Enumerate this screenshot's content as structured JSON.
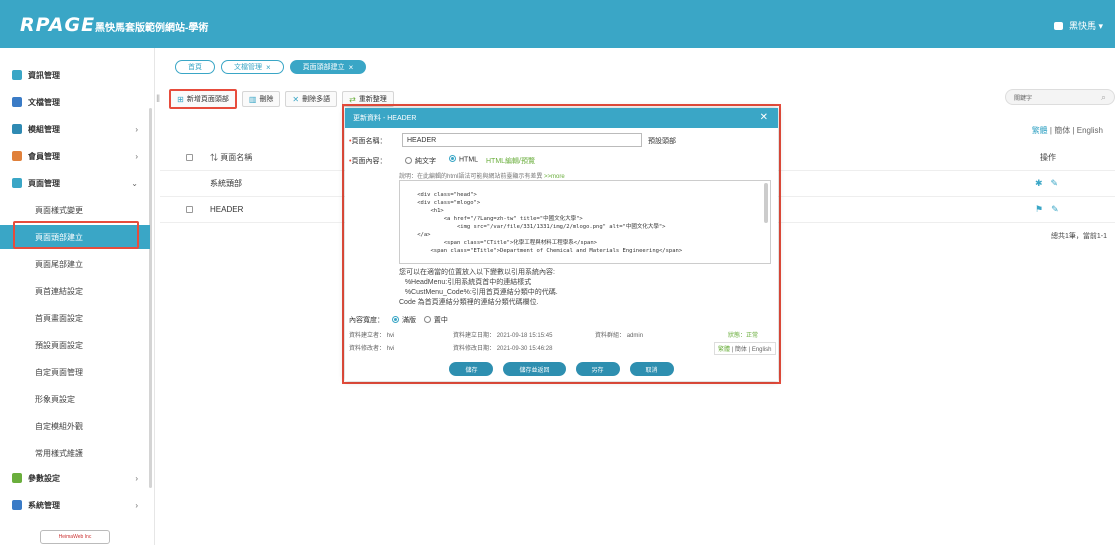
{
  "header": {
    "logo": "RPAGE",
    "site_name": "黑快馬套版範例網站-學術",
    "user": "黑快馬 ▾"
  },
  "sidebar": {
    "items": [
      {
        "label": "資訊管理",
        "color": "#3aa6c6"
      },
      {
        "label": "文檔管理",
        "color": "#3a7bc6"
      },
      {
        "label": "模組管理",
        "color": "#2f8ab3"
      },
      {
        "label": "會員管理",
        "color": "#e0803a"
      },
      {
        "label": "頁面管理",
        "color": "#3aa6c6"
      }
    ],
    "sub_items": [
      "頁面樣式變更",
      "頁面頭部建立",
      "頁面尾部建立",
      "頁首連結設定",
      "首頁畫面設定",
      "預設頁面設定",
      "自定頁面管理",
      "形象頁設定",
      "自定模組外觀",
      "常用樣式維護"
    ],
    "bottom_items": [
      {
        "label": "參數設定",
        "color": "#6aae3c"
      },
      {
        "label": "系統管理",
        "color": "#3a7bc6"
      }
    ],
    "powered": "HeimaWeb Inc"
  },
  "tabs": [
    {
      "label": "首頁",
      "closable": ""
    },
    {
      "label": "文檔管理",
      "closable": "×"
    },
    {
      "label": "頁面頭部建立",
      "closable": "×"
    }
  ],
  "toolbar": {
    "add": "新增頁面頭部",
    "delete": "刪除",
    "delete_multi": "刪除多語",
    "reorder": "重新整理"
  },
  "search": {
    "placeholder": "關鍵字"
  },
  "language": {
    "current": "繁體",
    "others": [
      "簡体",
      "English"
    ]
  },
  "table": {
    "headers": {
      "name": "頁面名稱",
      "op": "操作"
    },
    "rows": [
      {
        "name": "系統頭部"
      },
      {
        "name": "HEADER"
      }
    ],
    "pager": "總共1筆，當前1-1"
  },
  "modal": {
    "title": "更新資料 - HEADER",
    "name_label": "頁面名稱：",
    "name_value": "HEADER",
    "name_hint": "預設頭部",
    "content_label": "頁面內容：",
    "opt_text": "純文字",
    "opt_html": "HTML",
    "opt_editor": "HTML編輯/預覽",
    "note": "說明：在此編輯的html語法可能與網站前臺顯示有差異",
    "note_more": ">>more",
    "code": "<div class=\"head\">\n    <div class=\"mlogo\">\n        <h1>\n            <a href=\"/?Lang=zh-tw\" title=\"中國文化大學\">\n                <img src=\"/var/file/331/1331/img/2/mlogo.png\" alt=\"中國文化大學\">\n    </a>\n            <span class=\"CTitle\">化學工程與材料工程學系</span>\n        <span class=\"ETitle\">Department of Chemical and Materials Engineering</span>",
    "desc": "您可以在適當的位置放入以下變數以引用系統內容:\n   %HeadMenu:引用系統頁首中的連結樣式\n   %CustMenu_Code%:引用首頁連結分類中的代碼.\nCode 為首頁連結分類裡的連結分類代碼欄位.",
    "width_label": "內容寬度：",
    "width_full": "滿版",
    "width_center": "置中",
    "creator_label": "資料建立者：",
    "creator": "hvi",
    "created_label": "資料建立日期：",
    "created": "2021-09-18 15:15:45",
    "group_label": "資料群組：",
    "group": "admin",
    "status_label": "狀態：",
    "status": "正常",
    "modifier_label": "資料修改者：",
    "modifier": "hvi",
    "modified_label": "資料修改日期：",
    "modified": "2021-09-30 15:46:28",
    "langs": {
      "current": "繁體",
      "others": "簡体 | English"
    },
    "buttons": {
      "save": "儲存",
      "save_return": "儲存並返回",
      "save_as": "另存",
      "cancel": "取消"
    }
  }
}
